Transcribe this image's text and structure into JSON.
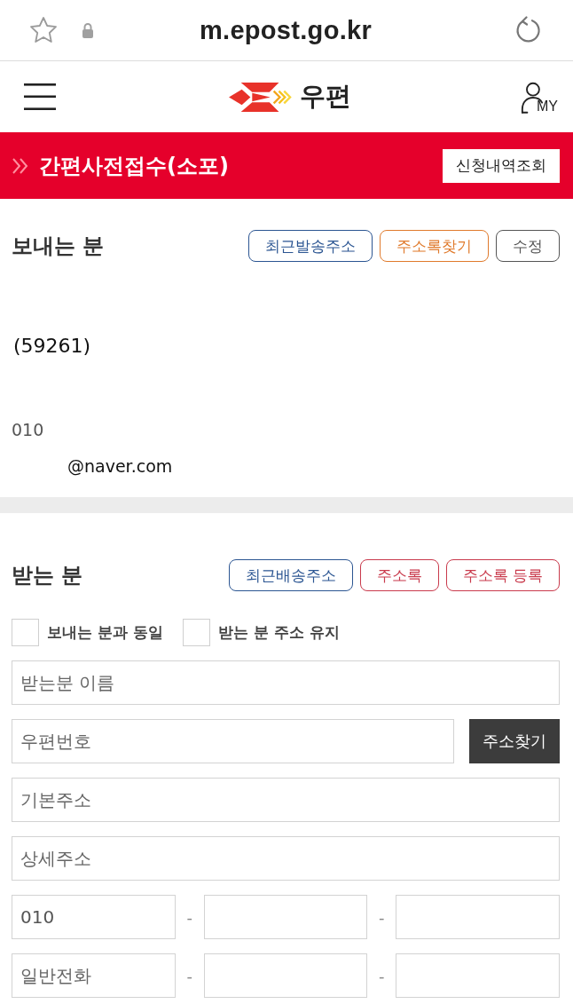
{
  "browser_bar": {
    "url": "m.epost.go.kr"
  },
  "header": {
    "logo_text": "우편",
    "account_label": "MY"
  },
  "banner": {
    "title": "간편사전접수(소포)",
    "button": "신청내역조회"
  },
  "sender": {
    "title": "보내는 분",
    "buttons": [
      {
        "label": "최근발송주소",
        "color": "#2b5592"
      },
      {
        "label": "주소록찾기",
        "color": "#e07a2c"
      },
      {
        "label": "수정",
        "color": "#555555"
      }
    ],
    "lines": [
      {
        "kind": "postcode",
        "text": "(59261)"
      },
      {
        "kind": "phone",
        "text": "010"
      },
      {
        "kind": "email",
        "text": "@naver.com"
      }
    ]
  },
  "receiver": {
    "title": "받는 분",
    "buttons": [
      {
        "label": "최근배송주소",
        "color": "#2b5592"
      },
      {
        "label": "주소록",
        "color": "#c93a4c"
      },
      {
        "label": "주소록 등록",
        "color": "#c93a4c"
      }
    ],
    "options": [
      {
        "label": "보내는 분과 동일",
        "checked": false
      },
      {
        "label": "받는 분 주소 유지",
        "checked": false
      }
    ],
    "fields": [
      {
        "kind": "text",
        "placeholder": "받는분 이름"
      },
      {
        "kind": "search",
        "placeholder": "우편번호",
        "button": "주소찾기"
      },
      {
        "kind": "text",
        "placeholder": "기본주소"
      },
      {
        "kind": "text",
        "placeholder": "상세주소"
      },
      {
        "kind": "phone",
        "parts": [
          {
            "value": "010"
          },
          {
            "prefix": "-"
          },
          {
            "prefix": "-"
          }
        ]
      },
      {
        "kind": "phone",
        "parts": [
          {
            "placeholder": "일반전화"
          },
          {
            "prefix": "-"
          },
          {
            "prefix": "-"
          }
        ]
      }
    ]
  }
}
